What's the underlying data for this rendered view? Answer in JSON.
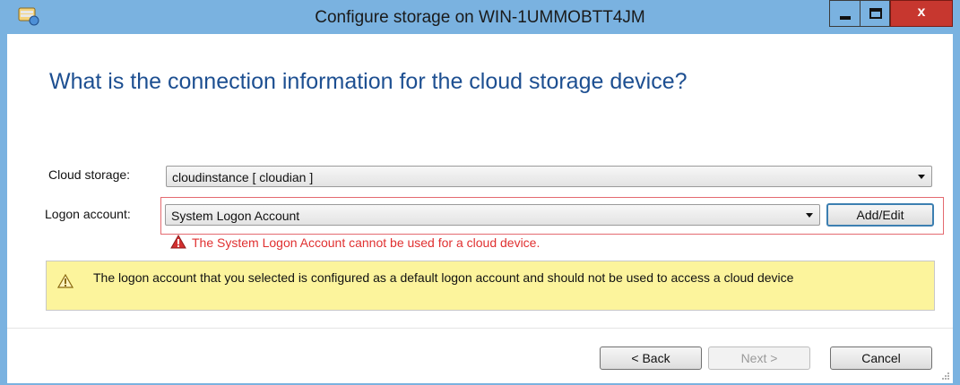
{
  "window": {
    "title": "Configure storage on WIN-1UMMOBTT4JM",
    "close_glyph": "x"
  },
  "heading": "What is the connection information for the cloud storage device?",
  "cloud_storage": {
    "label": "Cloud storage:",
    "value": "cloudinstance  [ cloudian ]"
  },
  "logon_account": {
    "label": "Logon account:",
    "value": "System Logon Account",
    "add_edit_label": "Add/Edit"
  },
  "error_message": "The System Logon Account cannot be used for a cloud device.",
  "warning_message": "The logon account that you selected is configured as a default logon account and should not be used to access a cloud device",
  "buttons": {
    "back": "< Back",
    "next": "Next >",
    "cancel": "Cancel"
  },
  "icons": [
    "app-icon",
    "minimize-icon",
    "maximize-icon",
    "close-icon",
    "dropdown-arrow-icon",
    "error-icon",
    "warning-icon",
    "resize-grip-icon"
  ],
  "colors": {
    "titlebar": "#7ab2e0",
    "heading": "#1d4f91",
    "error": "#e03030",
    "warning_bg": "#fcf49c",
    "close_button": "#c7372f"
  }
}
